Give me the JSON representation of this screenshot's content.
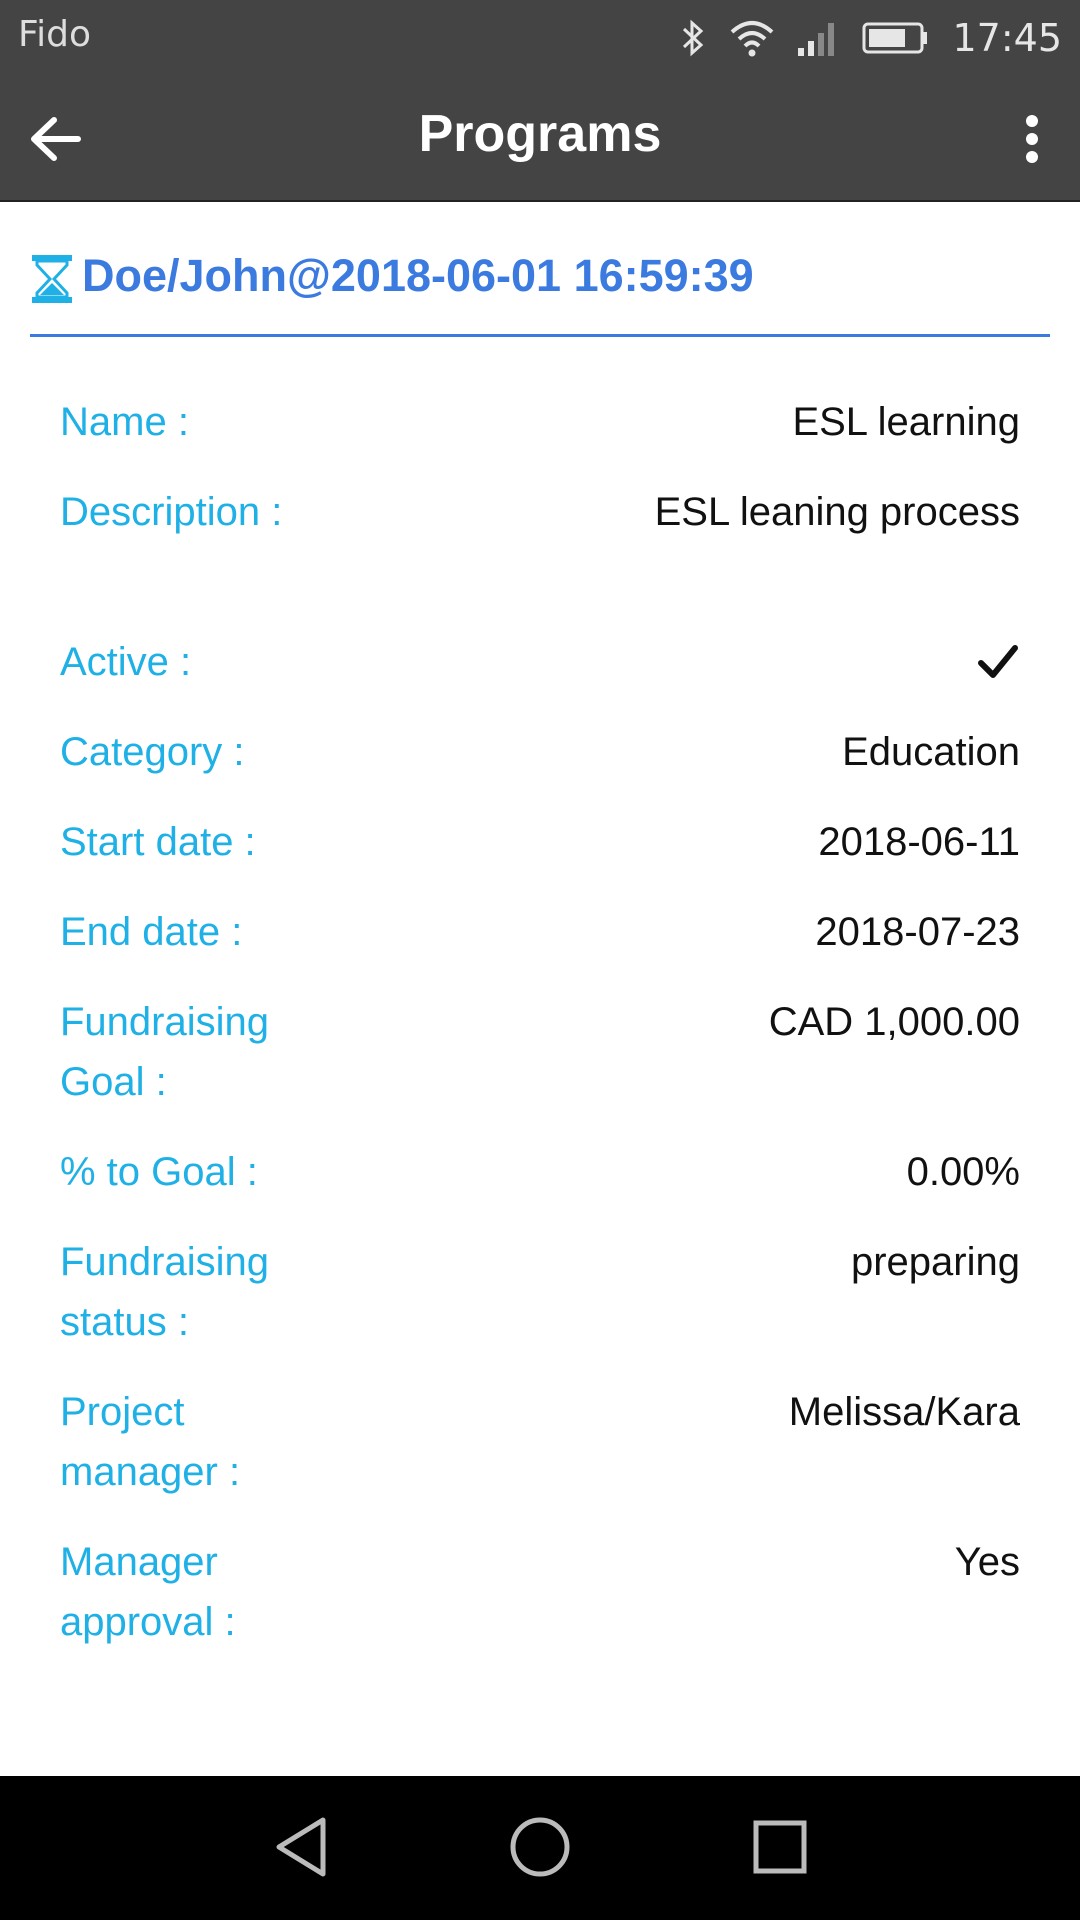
{
  "status_bar": {
    "carrier": "Fido",
    "time": "17:45",
    "icons": [
      "bluetooth-icon",
      "wifi-icon",
      "signal-icon",
      "battery-icon"
    ]
  },
  "app_bar": {
    "title": "Programs",
    "back_icon": "arrow-left-icon",
    "menu_icon": "more-vert-icon"
  },
  "record": {
    "title": "Doe/John@2018-06-01 16:59:39",
    "status_icon": "hourglass-icon",
    "accent_color": "#3b7be0"
  },
  "fields": [
    {
      "label": "Name :",
      "value": "ESL learning"
    },
    {
      "label": "Description :",
      "value": "ESL leaning process"
    },
    {
      "label": "Active :",
      "value": "",
      "checked": true
    },
    {
      "label": "Category :",
      "value": "Education"
    },
    {
      "label": "Start date :",
      "value": "2018-06-11"
    },
    {
      "label": "End date :",
      "value": "2018-07-23"
    },
    {
      "label": "Fundraising Goal :",
      "value": "CAD 1,000.00"
    },
    {
      "label": "% to Goal :",
      "value": "0.00%"
    },
    {
      "label": "Fundraising status :",
      "value": "preparing"
    },
    {
      "label": "Project manager :",
      "value": "Melissa/Kara"
    },
    {
      "label": "Manager approval :",
      "value": "Yes"
    }
  ],
  "colors": {
    "label": "#1fb0e6",
    "bar": "#444444"
  },
  "nav_bar": {
    "icons": [
      "back-triangle-icon",
      "home-circle-icon",
      "recents-square-icon"
    ]
  }
}
